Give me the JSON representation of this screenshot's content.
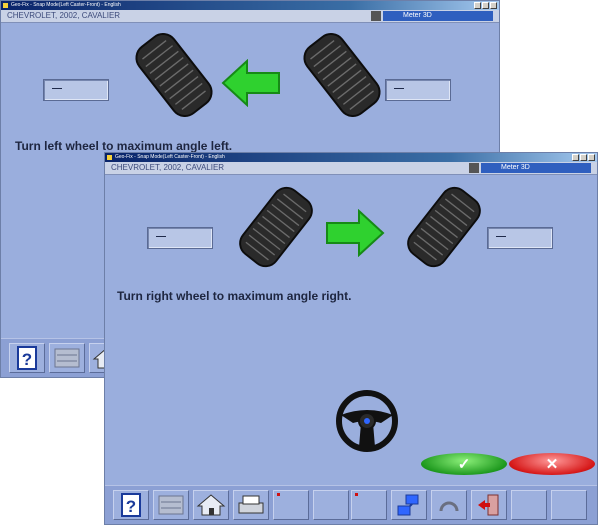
{
  "back_window": {
    "title": "Geo-Fix - Snap Mode(Left Caster-Front) - English",
    "vehicle": "CHEVROLET, 2002, CAVALIER",
    "meter_label": "Meter 3D",
    "left_readout": "—",
    "right_readout": "—",
    "instruction": "Turn left wheel to maximum angle left.",
    "arrow_direction": "left",
    "footer_icons": [
      "help-icon",
      "data-icon",
      "home-icon"
    ]
  },
  "front_window": {
    "title": "Geo-Fix - Snap Mode(Left Caster-Front) - English",
    "vehicle": "CHEVROLET, 2002, CAVALIER",
    "meter_label": "Meter 3D",
    "left_readout": "—",
    "right_readout": "—",
    "instruction": "Turn right wheel to maximum angle right.",
    "arrow_direction": "right",
    "ok_symbol": "✓",
    "cancel_symbol": "✕",
    "footer_icons": [
      "help-icon",
      "data-icon",
      "home-icon",
      "printer-icon",
      "marker-icon",
      "marker-icon",
      "network-icon",
      "measure-icon",
      "exit-icon",
      "blank",
      "blank"
    ]
  },
  "colors": {
    "window_bg": "#9aaedd",
    "titlebar": "#0a246a",
    "arrow": "#2fd12f",
    "ok": "#1f9a1f",
    "cancel": "#d61818"
  }
}
